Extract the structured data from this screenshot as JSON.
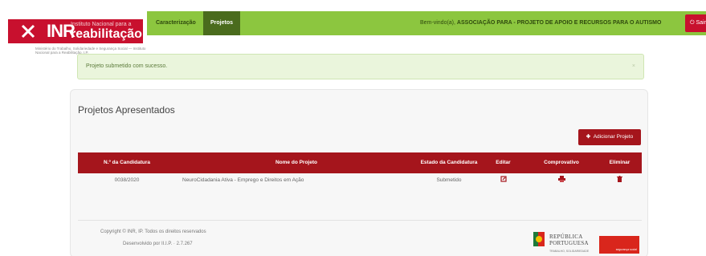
{
  "logo": {
    "acronym": "INR",
    "small_text": "Instituto Nacional para a",
    "name": "reabilitação",
    "subtitle": "Ministério do Trabalho, Solidariedade e Segurança Social — Instituto Nacional para a Reabilitação, I.P."
  },
  "nav": {
    "tabs": [
      {
        "label": "Caracterização"
      },
      {
        "label": "Projetos"
      }
    ],
    "welcome_prefix": "Bem-vindo(a),",
    "welcome_user": "ASSOCIAÇÃO PARA - PROJETO DE APOIO E RECURSOS PARA O AUTISMO",
    "logout_label": "Sair"
  },
  "alert": {
    "message": "Projeto submetido com sucesso.",
    "close": "×"
  },
  "panel": {
    "title": "Projetos Apresentados",
    "add_button": "Adicionar Projeto"
  },
  "table": {
    "headers": [
      "N.º da Candidatura",
      "Nome do Projeto",
      "Estado da Candidatura",
      "Editar",
      "Comprovativo",
      "Eliminar"
    ],
    "rows": [
      {
        "number": "0038/2020",
        "name": "NeuroCidadania Ativa - Emprego e Direitos em Ação",
        "status": "Submetido"
      }
    ]
  },
  "footer": {
    "copyright": "Copyright © INR, IP. Todos os direitos reservados",
    "developed": "Desenvolvido por II.I.P. · 2.7.267",
    "rep_line1": "REPÚBLICA",
    "rep_line2": "PORTUGUESA",
    "rep_sub": "TRABALHO, SOLIDARIEDADE",
    "rep_badge": "segurança social"
  },
  "colors": {
    "nav_green": "#8cc63f",
    "active_tab": "#4a6b1d",
    "brand_red": "#c8102e",
    "table_header": "#a5151c"
  },
  "icons": [
    "edit-icon",
    "print-icon",
    "trash-icon",
    "plus-icon",
    "logout-icon"
  ]
}
